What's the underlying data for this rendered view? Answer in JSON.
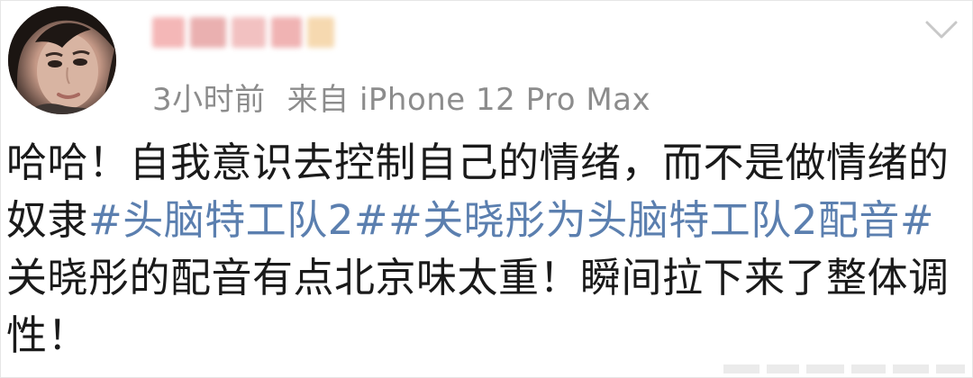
{
  "post": {
    "timestamp": "3小时前",
    "source": "来自 iPhone 12 Pro Max",
    "text_1": "哈哈！自我意识去控制自己的情绪，而不是做情绪的奴隶",
    "topic_1": "#头脑特工队2#",
    "topic_2": "#关晓彤为头脑特工队2配音#",
    "text_2": " 关晓彤的配音有点北京味太重！瞬间拉下来了整体调性！"
  },
  "colors": {
    "topic": "#5b7faf",
    "meta": "#8c8c8c",
    "text": "#1a1a1a"
  },
  "icons": {
    "expand": "chevron-down-icon"
  }
}
